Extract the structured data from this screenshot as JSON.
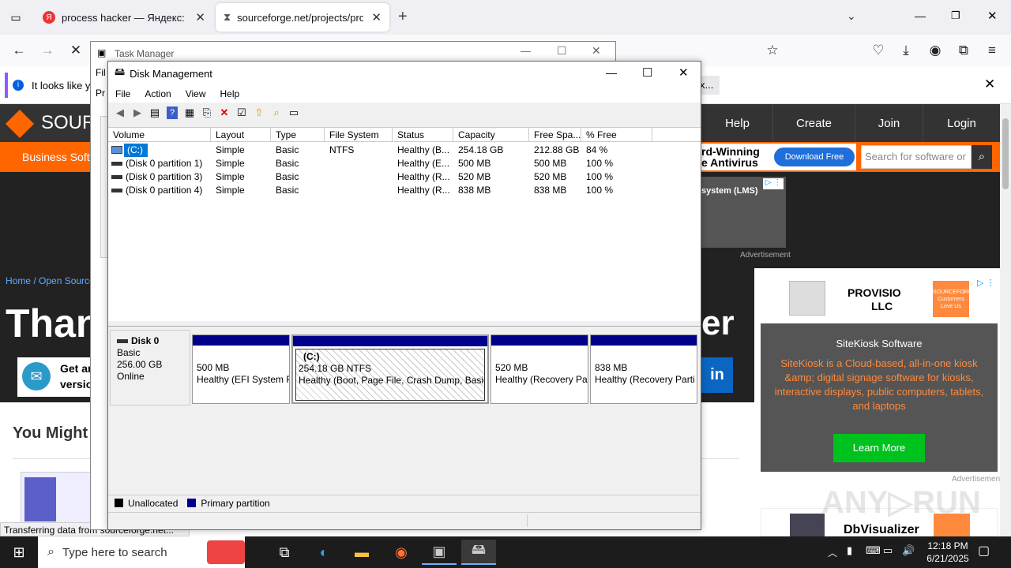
{
  "browser": {
    "tabs": [
      {
        "title": "process hacker — Яндекс: наш",
        "icon": "yandex-icon"
      },
      {
        "title": "sourceforge.net/projects/proce",
        "icon": "hourglass-icon"
      }
    ],
    "notification": "It looks like yo",
    "notification_btn": "x...",
    "status": "Transferring data from sourceforge.net..."
  },
  "sourceforge": {
    "logo": "SOUR",
    "nav": [
      "Help",
      "Create",
      "Join",
      "Login"
    ],
    "business": "Business Softw",
    "ad_line1": "rd-Winning",
    "ad_line2": "e Antivirus",
    "download_btn": "Download Free",
    "search_placeholder": "Search for software or",
    "ad_lms": "system (LMS)",
    "advertisement": "Advertisement",
    "breadcrumb": "Home / Open Source",
    "heading_left": "Than",
    "heading_right": "er",
    "get_a": "Get ar",
    "versio": "versio",
    "you_might": "You Might A",
    "provisio": "PROVISIO",
    "llc": "LLC",
    "sitekiosk_title": "SiteKiosk Software",
    "sitekiosk_desc": "SiteKiosk is a Cloud-based, all-in-one kiosk &amp; digital signage software for kiosks, interactive displays, public computers, tablets, and laptops",
    "learn_more": "Learn More",
    "advertisement2": "Advertisement",
    "dbvis": "DbVisualizer",
    "badge": "Customers Love Us",
    "badge_brand": "SOURCEFORGE"
  },
  "taskmanager": {
    "title": "Task Manager",
    "menu_f": "Fil",
    "menu_p": "Pr"
  },
  "diskmgmt": {
    "title": "Disk Management",
    "menu": [
      "File",
      "Action",
      "View",
      "Help"
    ],
    "columns": [
      "Volume",
      "Layout",
      "Type",
      "File System",
      "Status",
      "Capacity",
      "Free Spa...",
      "% Free"
    ],
    "rows": [
      [
        "(C:)",
        "Simple",
        "Basic",
        "NTFS",
        "Healthy (B...",
        "254.18 GB",
        "212.88 GB",
        "84 %"
      ],
      [
        "(Disk 0 partition 1)",
        "Simple",
        "Basic",
        "",
        "Healthy (E...",
        "500 MB",
        "500 MB",
        "100 %"
      ],
      [
        "(Disk 0 partition 3)",
        "Simple",
        "Basic",
        "",
        "Healthy (R...",
        "520 MB",
        "520 MB",
        "100 %"
      ],
      [
        "(Disk 0 partition 4)",
        "Simple",
        "Basic",
        "",
        "Healthy (R...",
        "838 MB",
        "838 MB",
        "100 %"
      ]
    ],
    "disk": {
      "name": "Disk 0",
      "type": "Basic",
      "size": "256.00 GB",
      "status": "Online"
    },
    "partitions": [
      {
        "label": "",
        "size": "500 MB",
        "status": "Healthy (EFI System P"
      },
      {
        "label": "(C:)",
        "size": "254.18 GB NTFS",
        "status": "Healthy (Boot, Page File, Crash Dump, Basic I"
      },
      {
        "label": "",
        "size": "520 MB",
        "status": "Healthy (Recovery Pa"
      },
      {
        "label": "",
        "size": "838 MB",
        "status": "Healthy (Recovery Parti"
      }
    ],
    "legend": [
      {
        "label": "Unallocated",
        "color": "#000000"
      },
      {
        "label": "Primary partition",
        "color": "#00008b"
      }
    ]
  },
  "taskbar": {
    "search_placeholder": "Type here to search",
    "time": "12:18 PM",
    "date": "6/21/2025"
  },
  "colors": {
    "sf_orange": "#ff6600",
    "partition_blue": "#00008b",
    "learn_more_green": "#00c21e"
  }
}
